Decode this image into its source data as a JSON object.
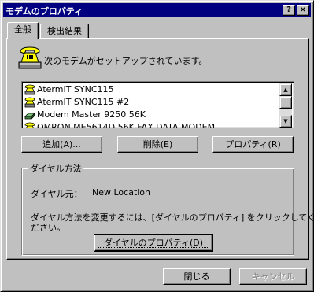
{
  "window": {
    "title": "モデムのプロパティ",
    "help_button": "?",
    "close_button": "×"
  },
  "tabs": [
    {
      "label": "全般",
      "active": true
    },
    {
      "label": "検出結果",
      "active": false
    }
  ],
  "general": {
    "heading": "次のモデムがセットアップされています。",
    "modems": [
      {
        "name": "AtermIT SYNC115",
        "icon": "phone-modem-icon"
      },
      {
        "name": "AtermIT SYNC115 #2",
        "icon": "phone-modem-icon"
      },
      {
        "name": "Modem Master 9250 56K",
        "icon": "external-modem-icon"
      },
      {
        "name": "OMRON ME5614D 56K FAX DATA MODEM",
        "icon": "phone-modem-icon"
      }
    ],
    "buttons": {
      "add": "追加(A)...",
      "remove": "削除(E)",
      "properties": "プロパティ(R)"
    },
    "dialing": {
      "group_label": "ダイヤル方法",
      "source_label": "ダイヤル元：",
      "source_value": "New Location",
      "instruction_line1": "ダイヤル方法を変更するには、[ダイヤルのプロパティ] をクリックしてく",
      "instruction_line2": "ださい。",
      "dialing_properties_button": "ダイヤルのプロパティ(D)"
    }
  },
  "footer": {
    "close_button": "閉じる",
    "cancel_button": "キャンセル",
    "cancel_disabled": true
  },
  "colors": {
    "titlebar": "#000080",
    "face": "#c0c0c0",
    "window_bg": "#ffffff"
  }
}
